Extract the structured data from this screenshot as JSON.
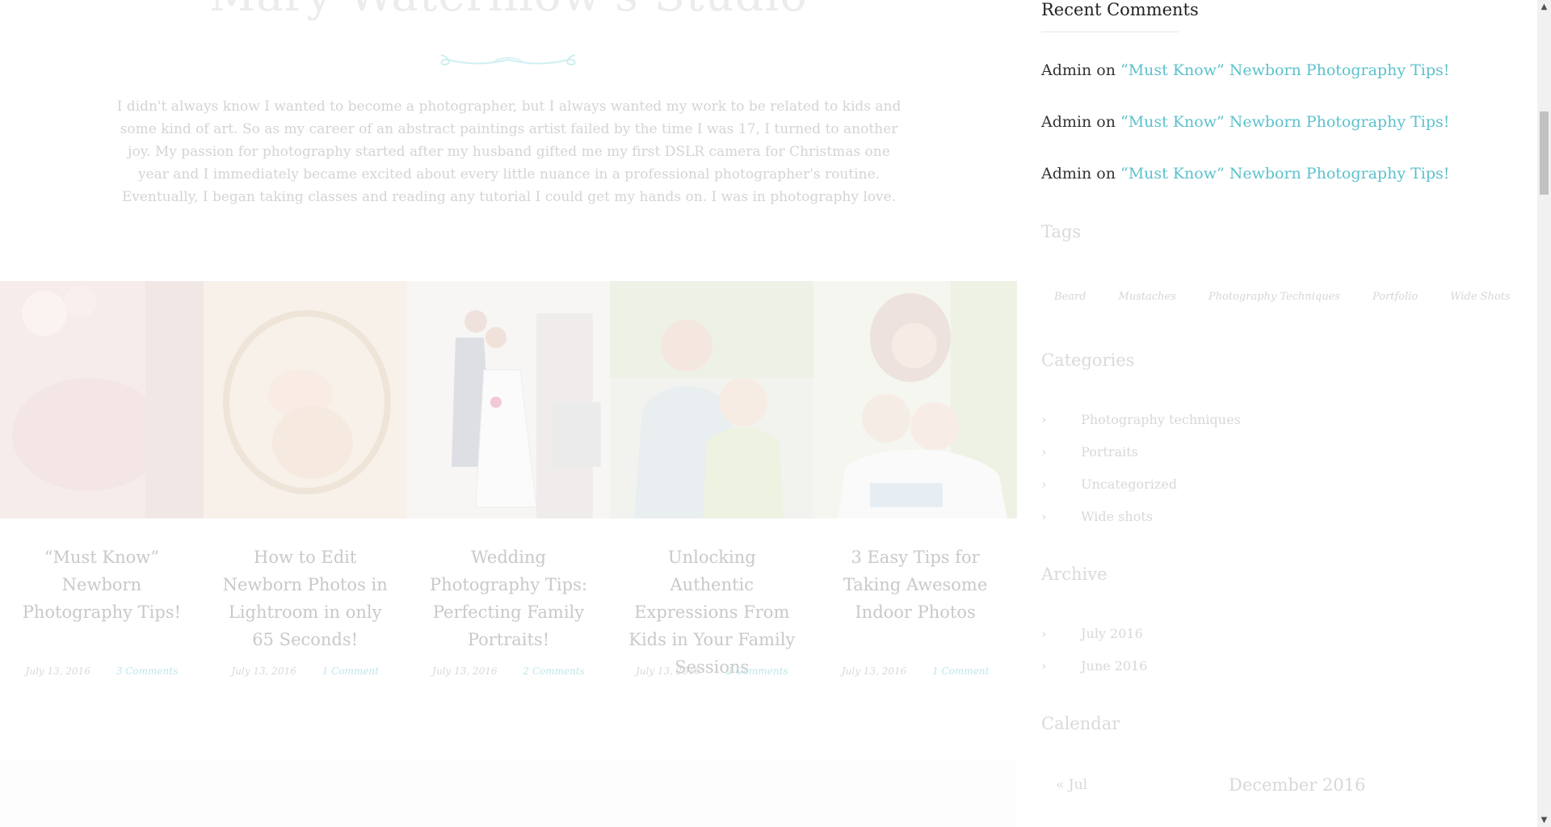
{
  "main": {
    "title": "Mary Waterlilow's Studio",
    "bio": "I didn't always know I wanted to become a photographer, but I always wanted my work to be related to kids and some kind of art. So as my career of an abstract paintings artist failed by the time I was 17, I turned to another joy. My passion for photography started after my husband gifted me my first DSLR camera for Christmas one year and I immediately became excited about every little nuance in a professional photographer's routine. Eventually, I began taking classes and reading any tutorial I could get my hands on. I was in photography love.",
    "posts": [
      {
        "title": "“Must Know” Newborn Photography Tips!",
        "date": "July 13, 2016",
        "comments": "3 Comments"
      },
      {
        "title": "How to Edit Newborn Photos in Lightroom in only 65 Seconds!",
        "date": "July 13, 2016",
        "comments": "1 Comment"
      },
      {
        "title": "Wedding Photography Tips: Perfecting Family Portraits!",
        "date": "July 13, 2016",
        "comments": "2 Comments"
      },
      {
        "title": "Unlocking Authentic Expressions From Kids in Your Family Sessions",
        "date": "July 13, 2016",
        "comments": "2 Comments"
      },
      {
        "title": "3 Easy Tips for Taking Awesome Indoor Photos",
        "date": "July 13, 2016",
        "comments": "1 Comment"
      }
    ]
  },
  "sidebar": {
    "recent_comments": {
      "title": "Recent Comments",
      "items": [
        {
          "author": "Admin",
          "on": "on",
          "link": "“Must Know” Newborn Photography Tips!"
        },
        {
          "author": "Admin",
          "on": "on",
          "link": "“Must Know” Newborn Photography Tips!"
        },
        {
          "author": "Admin",
          "on": "on",
          "link": "“Must Know” Newborn Photography Tips!"
        }
      ]
    },
    "tags": {
      "title": "Tags",
      "items": [
        "Beard",
        "Mustaches",
        "Photography Techniques",
        "Portfolio",
        "Wide Shots"
      ]
    },
    "categories": {
      "title": "Categories",
      "items": [
        "Photography techniques",
        "Portraits",
        "Uncategorized",
        "Wide shots"
      ]
    },
    "archive": {
      "title": "Archive",
      "items": [
        "July 2016",
        "June 2016"
      ]
    },
    "calendar": {
      "title": "Calendar",
      "prev": "« Jul",
      "month": "December 2016"
    }
  },
  "icons": {
    "chevron": "›",
    "scroll_up": "▲",
    "scroll_down": "▼"
  }
}
